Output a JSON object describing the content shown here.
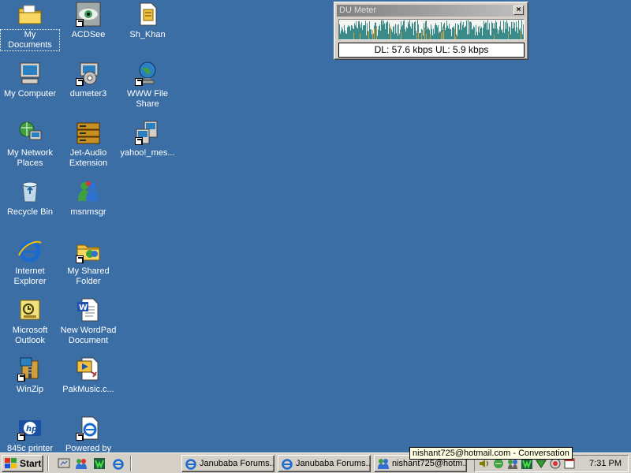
{
  "desktop": {
    "background": "#3a6ea5",
    "icons": [
      {
        "label": "My Documents",
        "icon": "folder-documents-icon"
      },
      {
        "label": "ACDSee",
        "icon": "acdsee-eye-icon"
      },
      {
        "label": "Sh_Khan",
        "icon": "text-file-icon"
      },
      {
        "label": "My Computer",
        "icon": "computer-icon"
      },
      {
        "label": "dumeter3",
        "icon": "dumeter-installer-icon"
      },
      {
        "label": "WWW File Share",
        "icon": "globe-share-icon"
      },
      {
        "label": "My Network Places",
        "icon": "network-places-icon"
      },
      {
        "label": "Jet-Audio Extension",
        "icon": "jetaudio-icon"
      },
      {
        "label": "yahoo!_mes...",
        "icon": "yahoo-messenger-icon"
      },
      {
        "label": "Recycle Bin",
        "icon": "recycle-bin-icon"
      },
      {
        "label": "msnmsgr",
        "icon": "msn-messenger-icon"
      },
      {
        "label": "Internet Explorer",
        "icon": "internet-explorer-icon"
      },
      {
        "label": "My Shared Folder",
        "icon": "shared-folder-icon"
      },
      {
        "label": "Microsoft Outlook",
        "icon": "outlook-icon"
      },
      {
        "label": "New WordPad Document",
        "icon": "wordpad-document-icon"
      },
      {
        "label": "WinZip",
        "icon": "winzip-icon"
      },
      {
        "label": "PakMusic.c...",
        "icon": "media-file-icon"
      },
      {
        "label": "845c printer",
        "icon": "hp-printer-icon"
      },
      {
        "label": "Powered by",
        "icon": "ie-document-icon"
      }
    ]
  },
  "du_meter": {
    "title": "DU Meter",
    "close_label": "×",
    "readout": "DL: 57.6 kbps   UL: 5.9 kbps",
    "download_color": "#3a8a8a",
    "upload_color": "#c8a040"
  },
  "tooltip": {
    "text": "nishant725@hotmail.com - Conversation"
  },
  "taskbar": {
    "start_label": "Start",
    "quick_launch": [
      {
        "icon": "show-desktop-icon"
      },
      {
        "icon": "msn-people-icon"
      },
      {
        "icon": "winamp-icon"
      },
      {
        "icon": "internet-explorer-icon"
      }
    ],
    "tasks": [
      {
        "label": "Janubaba Forums...",
        "icon": "internet-explorer-icon"
      },
      {
        "label": "Janubaba Forums...",
        "icon": "internet-explorer-icon"
      },
      {
        "label": "nishant725@hotm...",
        "icon": "msn-conversation-icon"
      }
    ],
    "tray_icons": [
      {
        "icon": "volume-icon"
      },
      {
        "icon": "network-activity-icon"
      },
      {
        "icon": "msn-tray-icon"
      },
      {
        "icon": "winamp-tray-icon"
      },
      {
        "icon": "download-tray-icon"
      },
      {
        "icon": "messenger-tray-icon"
      },
      {
        "icon": "calendar-tray-icon"
      }
    ],
    "clock": "7:31 PM"
  }
}
